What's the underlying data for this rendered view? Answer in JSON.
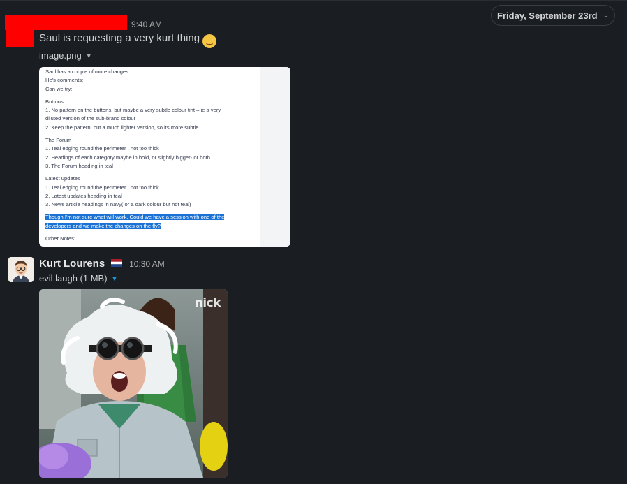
{
  "date_divider": {
    "label": "Friday, September 23rd",
    "chevron_icon": "chevron-down-icon"
  },
  "message1": {
    "time": "9:40 AM",
    "text": "Saul is requesting a very kurt thing",
    "emoji_icon": "laughing-tears-emoji-icon",
    "file_name": "image.png",
    "doc_lines": [
      "Saul has a couple of more changes.",
      "He's comments:",
      "Can we try:",
      "",
      "Buttons",
      "1. No pattern on the buttons, but maybe a very subtle colour tint – ie a very",
      "diluted version of the sub-brand colour",
      "2. Keep the pattern, but a much lighter version, so its more subtle",
      "",
      "The Forum",
      "1. Teal edging round the perimeter , not too thick",
      "2. Headings of each category maybe in bold, or slightly bigger- or both",
      "3. The Forum heading in teal",
      "",
      "Latest updates",
      "1. Teal edging round the perimeter , not too thick",
      "2. Latest updates heading in teal",
      "3. News article headings in navy( or a dark colour but not teal)"
    ],
    "doc_highlight": [
      "Though I'm not sure what will work. Could we have a session with one of the",
      "developers and we make the changes on the fly?"
    ],
    "doc_footer": "Other Notes:"
  },
  "message2": {
    "sender": "Kurt Lourens",
    "flag_icon": "netherlands-flag-icon",
    "time": "10:30 AM",
    "file_name": "evil laugh (1 MB)",
    "gif_logo": "nick"
  },
  "colors": {
    "background": "#1a1d21",
    "redaction": "#ff0000",
    "highlight": "#1a73d4",
    "link_caret": "#1d9bd1"
  }
}
